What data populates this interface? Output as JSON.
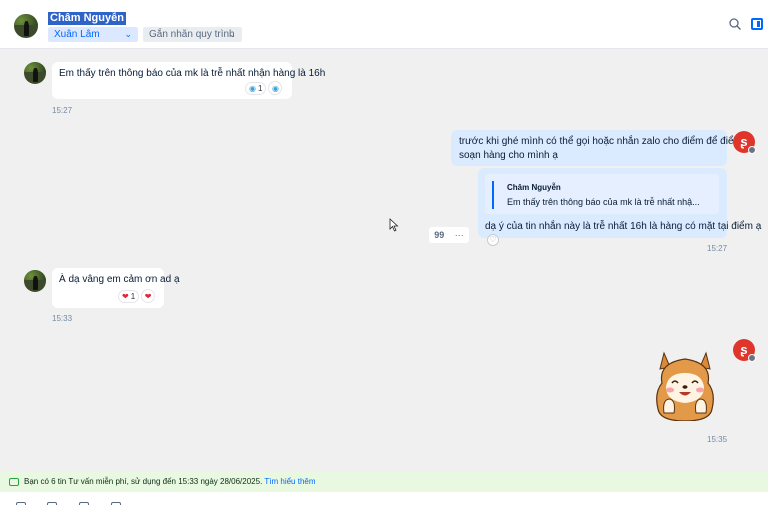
{
  "header": {
    "contact_name": "Châm Nguyễn",
    "member_select": "Xuân Lâm",
    "tag_select": "Gắn nhãn quy trình",
    "icons": [
      "search-icon",
      "side-panel-icon"
    ]
  },
  "messages": [
    {
      "direction": "incoming",
      "text": "Em thấy trên thông báo của mk là trễ nhất nhận hàng là 16h",
      "time": "15:27",
      "reaction_count": "1",
      "reaction_icons": [
        "globe-reaction-icon",
        "globe-reaction-icon"
      ]
    },
    {
      "direction": "outgoing",
      "text_line1": "trước khi ghé mình có thể gọi hoặc nhắn zalo cho điểm để điểm",
      "text_line2": "soạn hàng cho mình ạ"
    },
    {
      "direction": "outgoing",
      "quote_name": "Châm Nguyễn",
      "quote_text": "Em thấy trên thông báo của mk là trễ nhất nhậ...",
      "text": "dạ ý của tin nhắn này là trễ nhất 16h là hàng có mặt tại điểm ạ",
      "time": "15:27"
    },
    {
      "direction": "incoming",
      "text": "À dạ vâng em cảm ơn ad ạ",
      "time": "15:33",
      "reaction_count": "1",
      "reaction_icons": [
        "heart-reaction-icon",
        "heart-reaction-icon"
      ]
    },
    {
      "direction": "outgoing",
      "sticker": "shiba-dog-sticker",
      "time": "15:35"
    }
  ],
  "message_tools": {
    "quote_glyph": "99",
    "more_glyph": "···"
  },
  "notice": {
    "text": "Bạn có 6 tin Tư vấn miễn phí, sử dụng đến 15:33 ngày 28/06/2025.",
    "link": "Tìm hiểu thêm"
  },
  "colors": {
    "accent": "#0068ff",
    "outgoing_bubble": "#dbebff",
    "notice_bg": "#e9f8e1",
    "brand_red": "#e0352b"
  }
}
